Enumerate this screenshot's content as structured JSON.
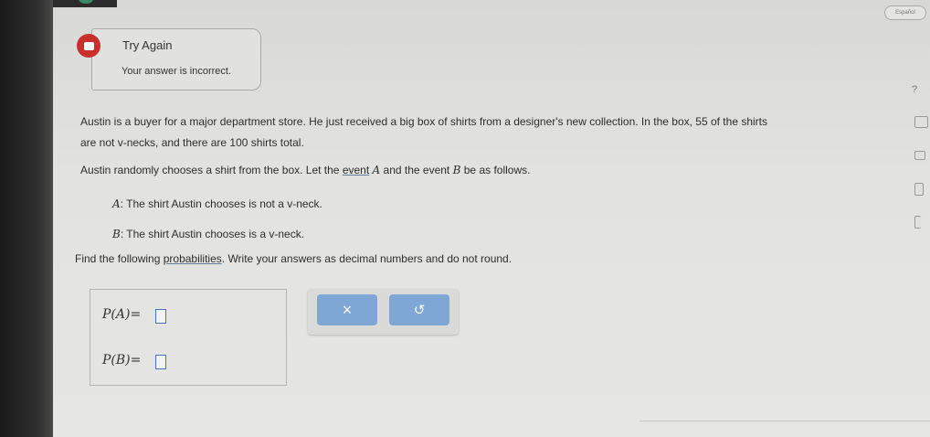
{
  "header": {
    "language_button": "Español",
    "help_icon": "?"
  },
  "feedback": {
    "title": "Try Again",
    "message": "Your answer is incorrect."
  },
  "question": {
    "line1": "Austin is a buyer for a major department store. He just received a big box of shirts from a designer's new collection. In the box, 55 of the shirts",
    "line2": "are not v-necks, and there are 100 shirts total.",
    "line3_pre": "Austin randomly chooses a shirt from the box. Let the ",
    "line3_link": "event",
    "line3_mid": " and the event ",
    "line3_post": " be as follows.",
    "event_a_var": "A",
    "event_b_var": "B",
    "event_a_text": ": The shirt Austin chooses is not a v-neck.",
    "event_b_text": ": The shirt Austin chooses is a v-neck.",
    "instr_pre": "Find the following ",
    "instr_link": "probabilities",
    "instr_post": ". Write your answers as decimal numbers and do not round."
  },
  "answers": {
    "pa_label": "P(A)",
    "pb_label": "P(B)",
    "equals": "=",
    "pa_value": "",
    "pb_value": ""
  },
  "buttons": {
    "clear": "×",
    "undo": "↺"
  },
  "icons": [
    "speech-bubble-icon",
    "help-icon",
    "calculator-icon",
    "video-icon",
    "book-icon",
    "bracket-icon",
    "clear-x-icon",
    "undo-icon"
  ],
  "colors": {
    "error": "#c9302c",
    "button": "#7fa7d6",
    "input_border": "#4a72c4"
  }
}
